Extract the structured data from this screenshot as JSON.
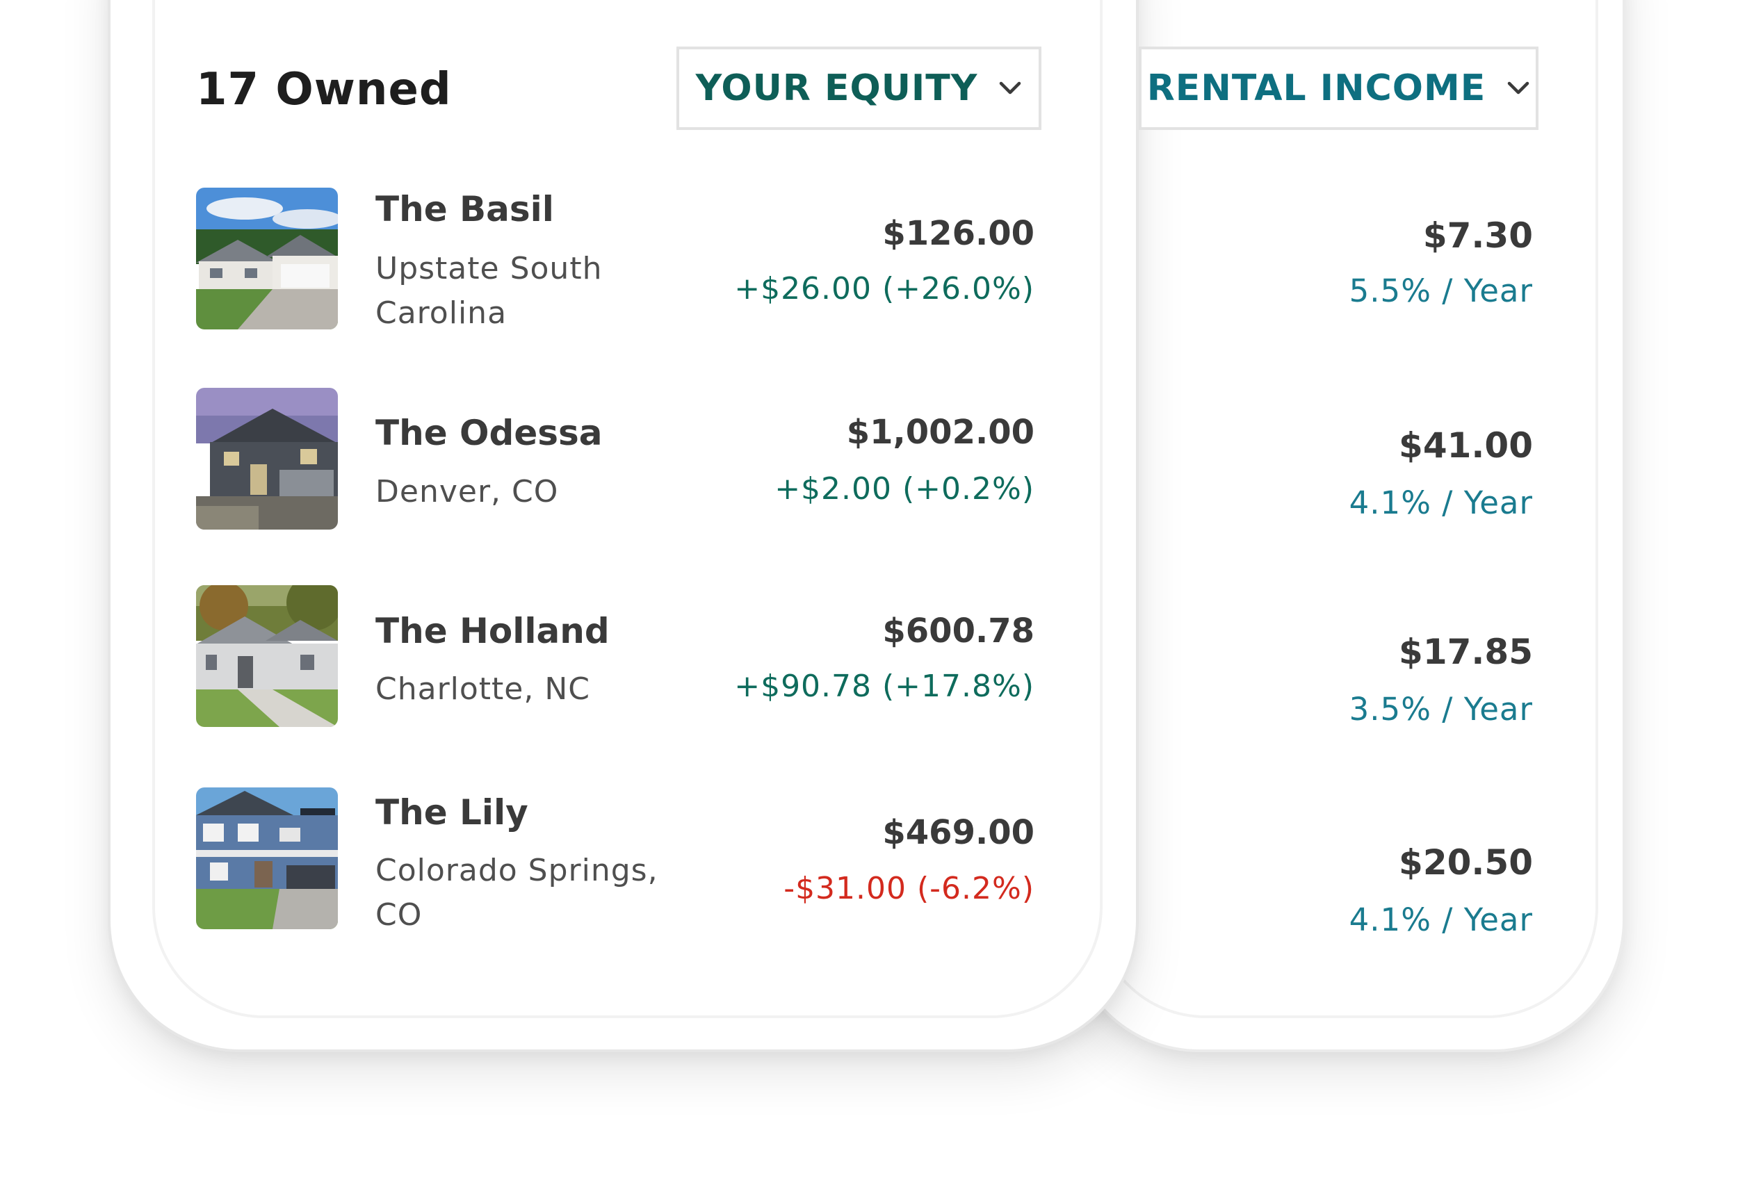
{
  "header": {
    "owned_title": "17 Owned",
    "equity_dropdown_label": "YOUR EQUITY",
    "rental_dropdown_label": "RENTAL INCOME"
  },
  "colors": {
    "equity_accent": "#0e5e57",
    "rental_accent": "#0e6f80",
    "positive_change": "#0e6b5c",
    "negative_change": "#d32a1e",
    "yield_text": "#1a7b8f"
  },
  "properties": [
    {
      "name": "The Basil",
      "location": "Upstate South Carolina",
      "equity_value": "$126.00",
      "equity_change": "+$26.00 (+26.0%)",
      "change_direction": "positive",
      "rental_income": "$7.30",
      "rental_yield": "5.5% / Year",
      "photo": "house-photo-basil"
    },
    {
      "name": "The Odessa",
      "location": "Denver, CO",
      "equity_value": "$1,002.00",
      "equity_change": "+$2.00 (+0.2%)",
      "change_direction": "positive",
      "rental_income": "$41.00",
      "rental_yield": "4.1% / Year",
      "photo": "house-photo-odessa"
    },
    {
      "name": "The Holland",
      "location": "Charlotte, NC",
      "equity_value": "$600.78",
      "equity_change": "+$90.78 (+17.8%)",
      "change_direction": "positive",
      "rental_income": "$17.85",
      "rental_yield": "3.5% / Year",
      "photo": "house-photo-holland"
    },
    {
      "name": "The Lily",
      "location": "Colorado Springs, CO",
      "equity_value": "$469.00",
      "equity_change": "-$31.00 (-6.2%)",
      "change_direction": "negative",
      "rental_income": "$20.50",
      "rental_yield": "4.1% / Year",
      "photo": "house-photo-lily"
    }
  ]
}
